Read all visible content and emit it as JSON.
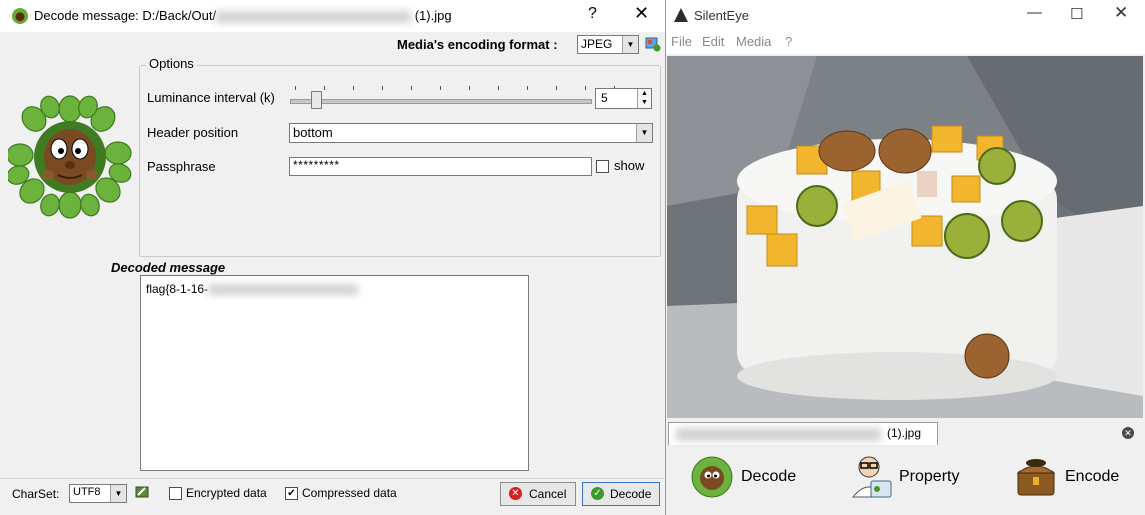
{
  "decode_dialog": {
    "title": "Decode message: D:/Back/Out/",
    "title_suffix": "(1).jpg",
    "help": "?",
    "close": "✕",
    "media_format_label": "Media's encoding format :",
    "media_format_value": "JPEG",
    "options_title": "Options",
    "luminance_label": "Luminance interval (k)",
    "luminance_value": "5",
    "header_label": "Header position",
    "header_value": "bottom",
    "passphrase_label": "Passphrase",
    "passphrase_value": "*********",
    "show_label": "show",
    "decoded_label": "Decoded message",
    "decoded_text": "flag{8-1-16-",
    "charset_label": "CharSet:",
    "charset_value": "UTF8",
    "encrypted_label": "Encrypted data",
    "compressed_label": "Compressed data",
    "compressed_checked": true,
    "cancel_label": "Cancel",
    "decode_label": "Decode"
  },
  "main_window": {
    "title": "SilentEye",
    "menu": [
      "File",
      "Edit",
      "Media",
      "?"
    ],
    "tab_label": "(1).jpg",
    "buttons": {
      "decode": "Decode",
      "property": "Property",
      "encode": "Encode"
    }
  }
}
